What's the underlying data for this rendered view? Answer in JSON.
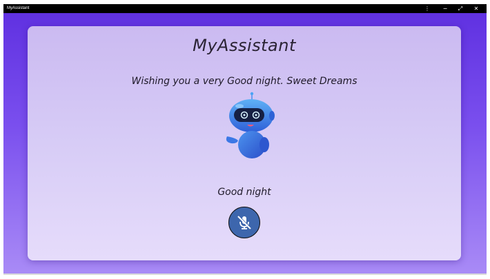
{
  "window": {
    "title": "MyAssistant",
    "controls": {
      "menu": "⋮",
      "minimize": "−",
      "restore": "⤢",
      "close": "✕"
    }
  },
  "assistant": {
    "name": "MyAssistant",
    "greeting": "Wishing you a very Good night. Sweet Dreams",
    "status": "Good night",
    "avatar_icon": "robot-icon",
    "mic_icon": "mic-off-icon"
  },
  "colors": {
    "background_top": "#5e2fe0",
    "background_bottom": "#a98bf6",
    "card": "#d7ccf6",
    "mic_button": "#3d66ad"
  }
}
